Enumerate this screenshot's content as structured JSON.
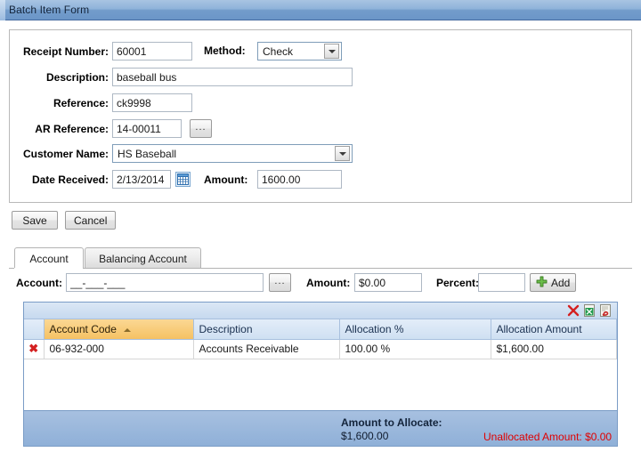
{
  "window": {
    "title": "Batch Item Form"
  },
  "form": {
    "fields": [
      {
        "label": "Receipt Number:",
        "value": "60001",
        "placeholder": ""
      },
      {
        "label": "Method:",
        "value": "Check",
        "placeholder": ""
      },
      {
        "label": "Description:",
        "value": "baseball bus",
        "placeholder": ""
      },
      {
        "label": "Reference:",
        "value": "ck9998",
        "placeholder": ""
      },
      {
        "label": "AR Reference:",
        "value": "14-00011",
        "placeholder": ""
      },
      {
        "label": "Customer Name:",
        "value": "HS Baseball",
        "placeholder": ""
      },
      {
        "label": "Date Received:",
        "value": "2/13/2014",
        "placeholder": ""
      },
      {
        "label": "Amount:",
        "value": "1600.00",
        "placeholder": ""
      }
    ],
    "ar_browse_label": "...",
    "save_label": "Save",
    "cancel_label": "Cancel"
  },
  "tabs": [
    {
      "label": "Account",
      "active": true
    },
    {
      "label": "Balancing Account",
      "active": false
    }
  ],
  "allocation": {
    "account_label": "Account:",
    "account_value": "__-___-___",
    "account_browse_label": "...",
    "amount_label": "Amount:",
    "amount_value": "$0.00",
    "percent_label": "Percent:",
    "percent_value": "",
    "add_label": "Add"
  },
  "grid": {
    "toolbar": {
      "delete_icon": "red-x-icon",
      "excel_icon": "excel-export-icon",
      "pdf_icon": "pdf-export-icon"
    },
    "columns": [
      "",
      "Account Code",
      "Description",
      "Allocation %",
      "Allocation Amount"
    ],
    "sorted_column": "Account Code",
    "sort_direction": "ascending",
    "rows": [
      {
        "delete": "✖",
        "account_code": "06-932-000",
        "description": "Accounts Receivable",
        "allocation_percent": "100.00 %",
        "allocation_amount": "$1,600.00"
      }
    ],
    "footer": {
      "amount_to_allocate_label": "Amount to Allocate:",
      "amount_to_allocate_value": "$1,600.00",
      "unallocated_text": "Unallocated Amount: $0.00"
    }
  },
  "colors": {
    "title_bar": "#8fb3da",
    "sorted_header": "#f5c163",
    "grid_header": "#cfe0f2",
    "footer_band": "#8fb0d8",
    "alert_text": "#e00000",
    "add_icon": "#55a23b"
  }
}
